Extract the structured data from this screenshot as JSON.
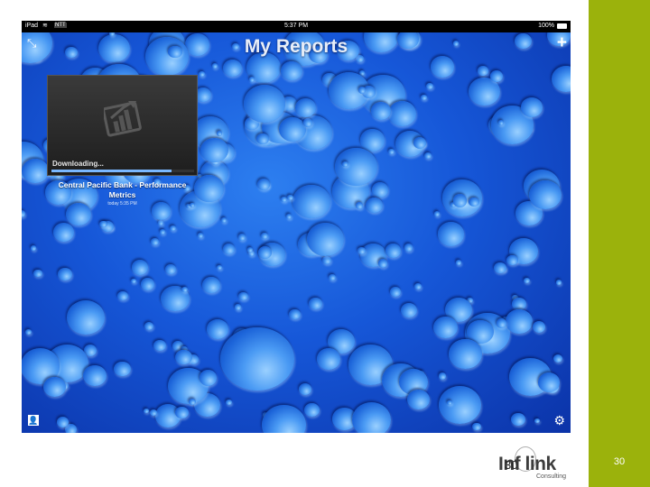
{
  "status_bar": {
    "device": "iPad",
    "carrier": "NTT",
    "time": "5:37 PM",
    "battery": "100%"
  },
  "screen": {
    "title": "My Reports",
    "icons": {
      "collapse": "collapse-arrows-icon",
      "add": "plus-icon",
      "profile": "profile-icon",
      "settings": "gear-icon"
    }
  },
  "report": {
    "status": "Downloading...",
    "progress_fraction": 0.84,
    "title": "Central Pacific Bank - Performance Metrics",
    "date": "today 5:35 PM"
  },
  "footer": {
    "logo_main": "Inf link",
    "logo_sub": "Consulting",
    "overlay_number": "30"
  },
  "slide": {
    "page_number": "30",
    "accent_color": "#9bb20c"
  }
}
